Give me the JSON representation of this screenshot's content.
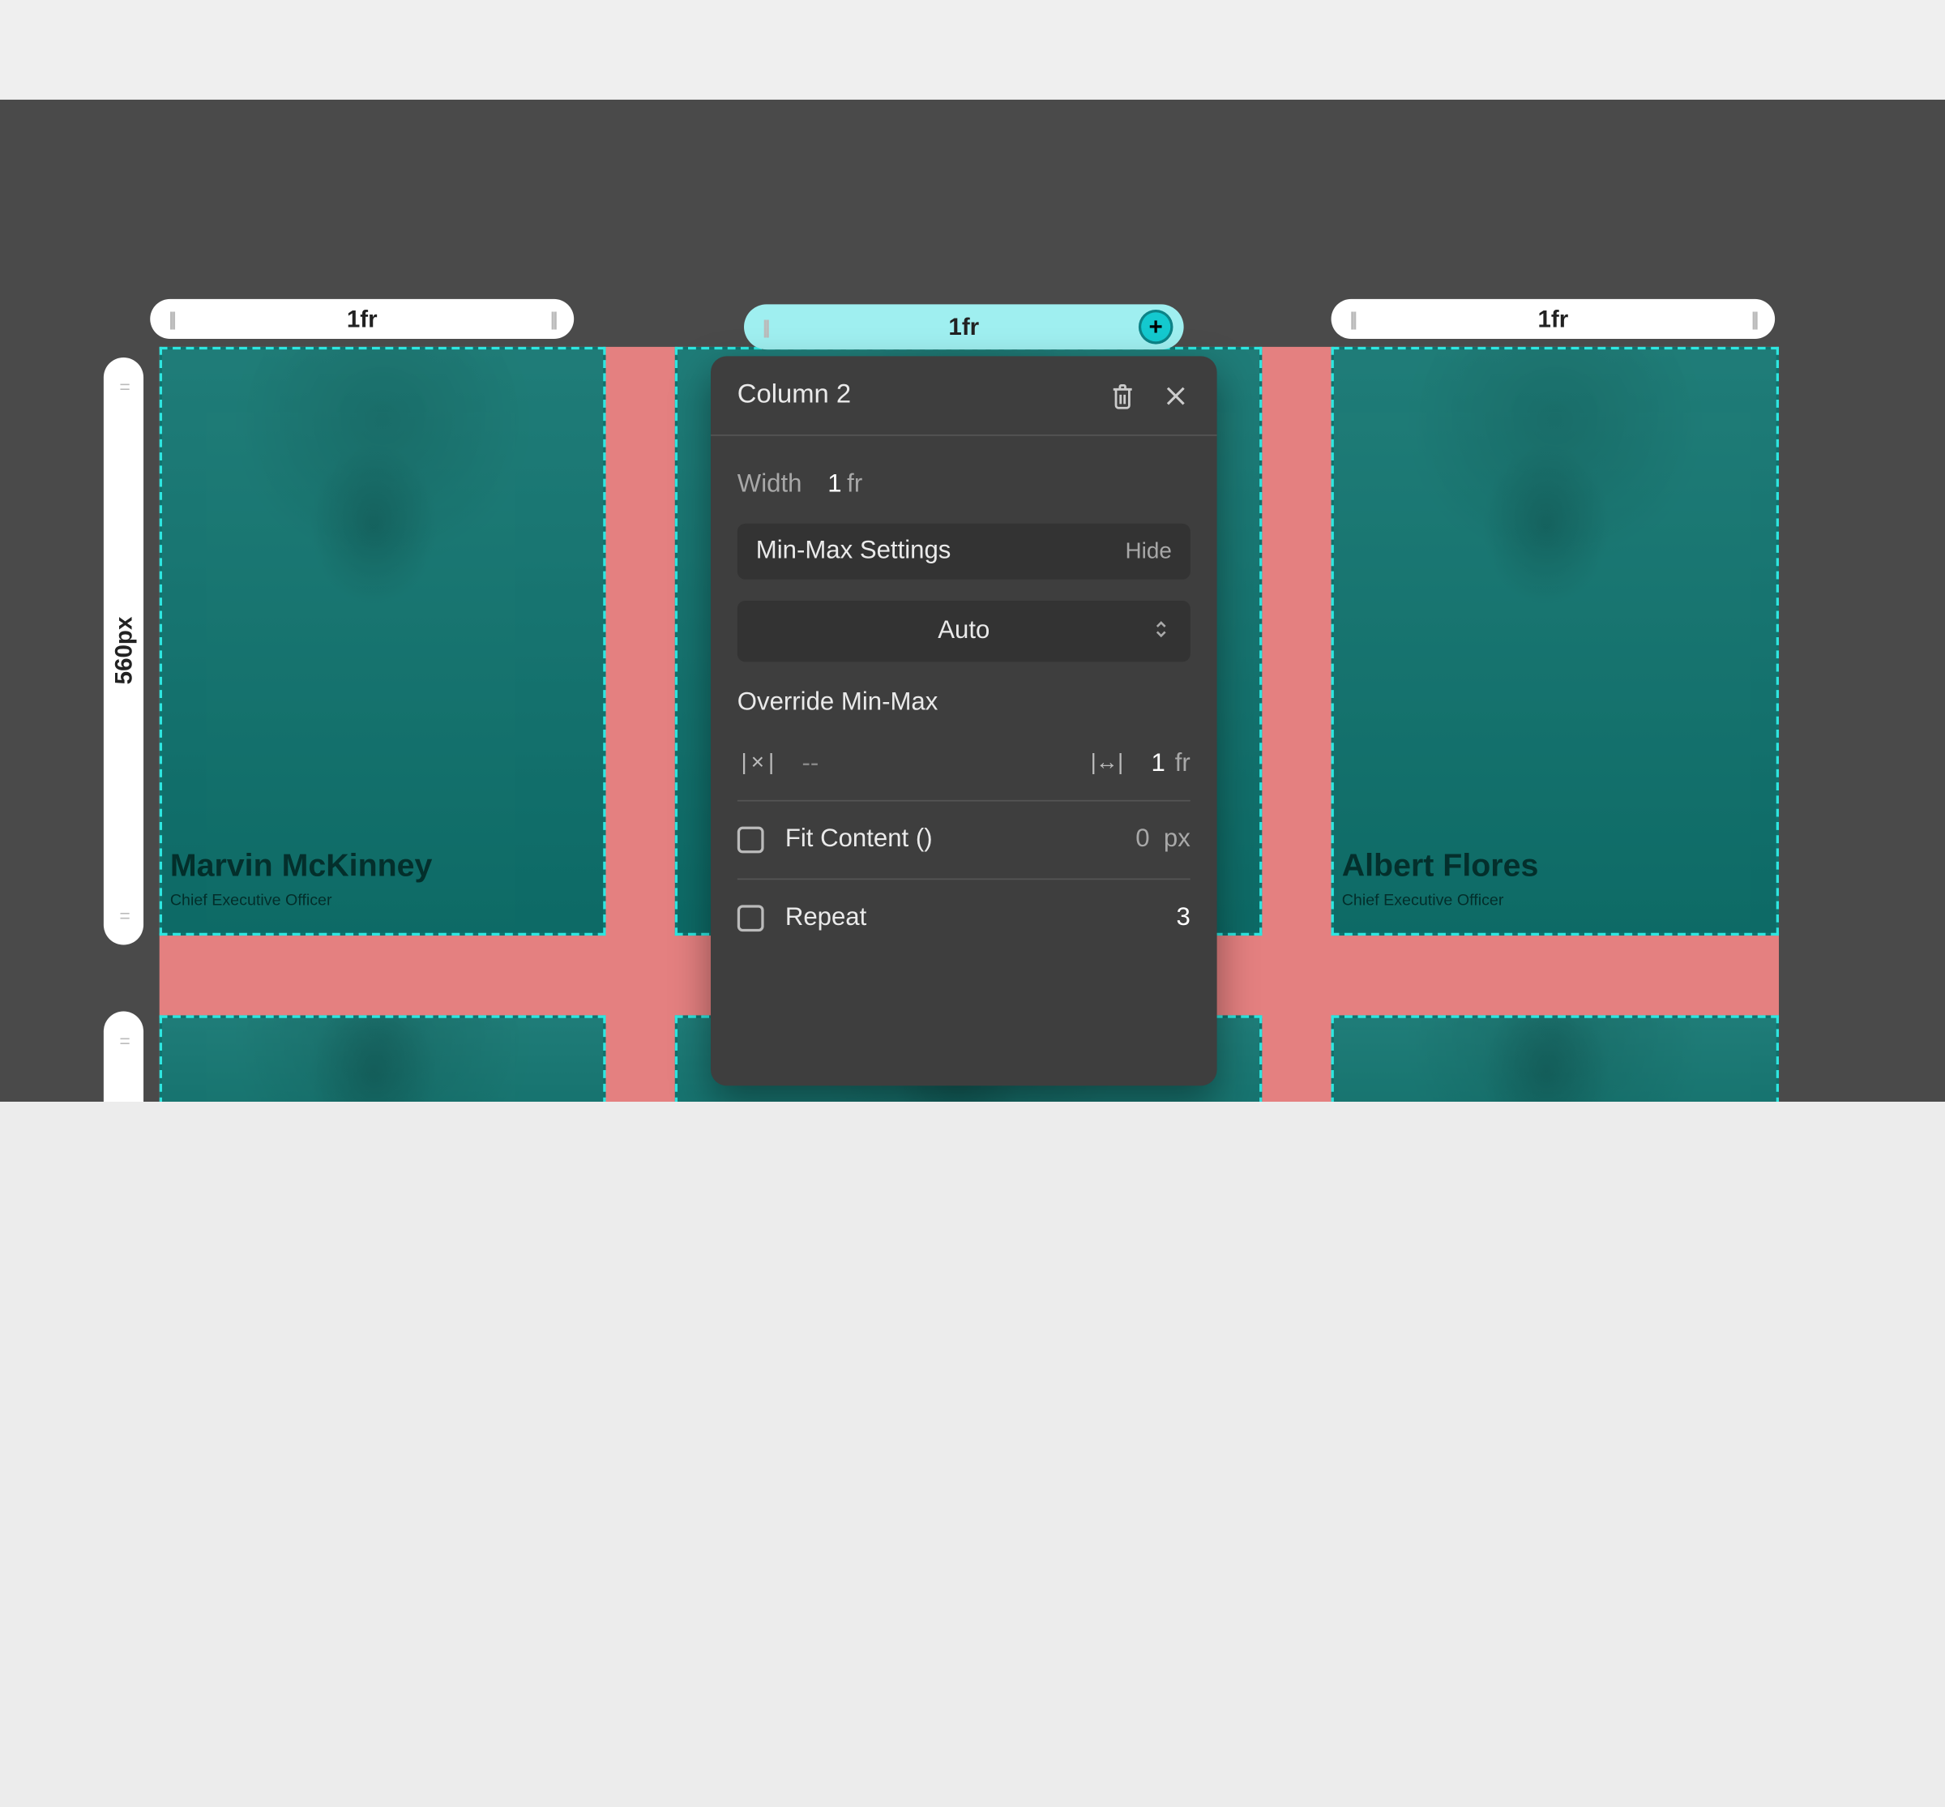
{
  "columns": [
    {
      "label": "1fr",
      "active": false
    },
    {
      "label": "1fr",
      "active": true
    },
    {
      "label": "1fr",
      "active": false
    }
  ],
  "rows": [
    {
      "label": "560px"
    }
  ],
  "cards": [
    {
      "name": "Marvin McKinney",
      "role": "Chief Executive Officer"
    },
    {
      "name": "",
      "role": ""
    },
    {
      "name": "Albert Flores",
      "role": "Chief Executive Officer"
    },
    {
      "name": "",
      "role": ""
    },
    {
      "name": "",
      "role": ""
    },
    {
      "name": "",
      "role": ""
    }
  ],
  "popup": {
    "title": "Column 2",
    "width": {
      "label": "Width",
      "value": "1",
      "unit": "fr"
    },
    "minmax": {
      "section_label": "Min-Max Settings",
      "toggle": "Hide"
    },
    "mode": "Auto",
    "override": {
      "label": "Override Min-Max",
      "min_value": "--",
      "max_value": "1",
      "max_unit": "fr"
    },
    "fit": {
      "label": "Fit Content ()",
      "value": "0",
      "unit": "px"
    },
    "repeat": {
      "label": "Repeat",
      "value": "3"
    }
  }
}
